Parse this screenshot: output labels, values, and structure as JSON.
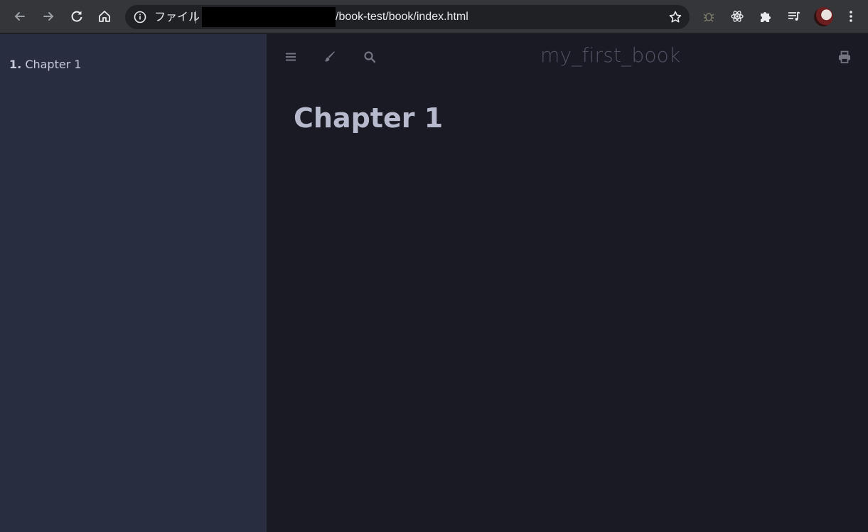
{
  "browser": {
    "url_scheme_label": "ファイル",
    "url_path": "/book-test/book/index.html"
  },
  "sidebar": {
    "items": [
      {
        "number": "1.",
        "label": "Chapter 1"
      }
    ]
  },
  "menu_bar": {
    "book_title": "my_first_book"
  },
  "content": {
    "heading": "Chapter 1"
  },
  "colors": {
    "sidebar_bg": "#282d3f",
    "content_bg": "#191a23",
    "heading": "#b7b9cc",
    "menu_icon": "#737480"
  }
}
